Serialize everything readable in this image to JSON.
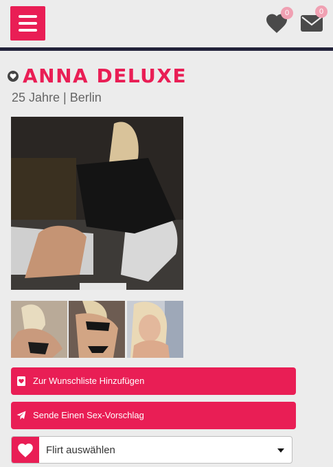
{
  "header": {
    "menu_icon": "hamburger-icon",
    "favorites_icon": "heart-icon",
    "favorites_badge": "0",
    "messages_icon": "envelope-icon",
    "messages_badge": "0",
    "accent_color": "#e91e55",
    "divider_color": "#22223a"
  },
  "profile": {
    "name": "ANNA DELUXE",
    "name_icon": "heart-shield-icon",
    "details": "25 Jahre | Berlin"
  },
  "gallery": {
    "main_photo": "profile-photo-main",
    "thumbnails": [
      "profile-photo-thumb-1",
      "profile-photo-thumb-2",
      "profile-photo-thumb-3"
    ]
  },
  "actions": {
    "wishlist": {
      "label": "Zur Wunschliste Hinzufügen",
      "icon": "bookmark-heart-icon"
    },
    "proposal": {
      "label": "Sende Einen Sex-Vorschlag",
      "icon": "paper-plane-icon"
    }
  },
  "flirt_select": {
    "icon": "heart-icon",
    "selected": "Flirt auswählen",
    "caret_icon": "caret-down-icon"
  }
}
